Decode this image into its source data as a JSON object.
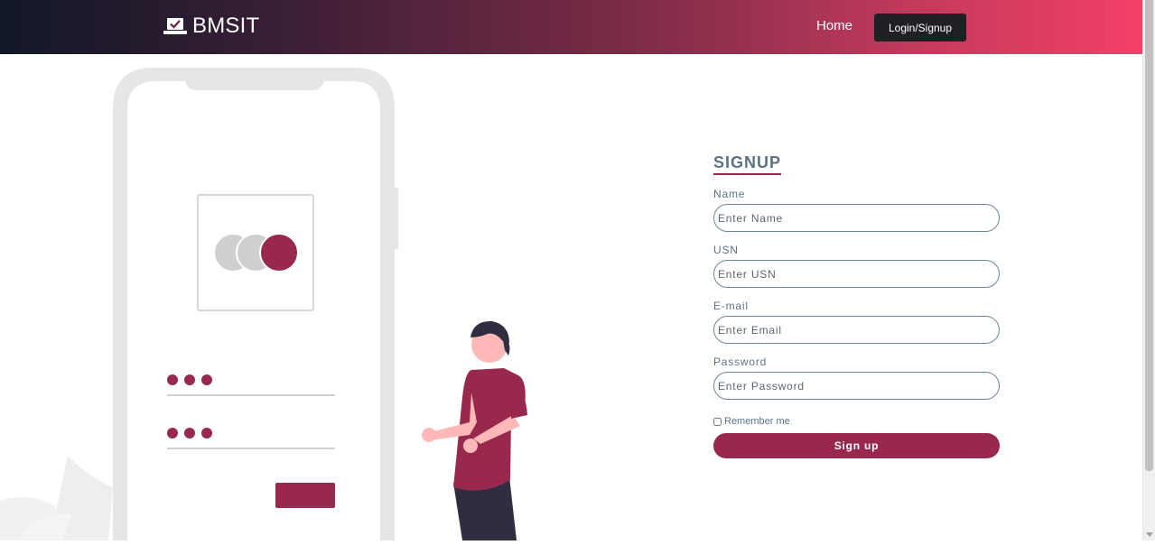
{
  "navbar": {
    "brand": "BMSIT",
    "brand_icon": "laptop-check-icon",
    "home_link": "Home",
    "login_button": "Login/Signup",
    "gradient_start": "#111827",
    "gradient_end": "#f43f67"
  },
  "form": {
    "title": "SIGNUP",
    "fields": [
      {
        "label": "Name",
        "placeholder": "Enter Name",
        "value": ""
      },
      {
        "label": "USN",
        "placeholder": "Enter USN",
        "value": ""
      },
      {
        "label": "E-mail",
        "placeholder": "Enter Email",
        "value": ""
      },
      {
        "label": "Password",
        "placeholder": "Enter Password",
        "value": ""
      }
    ],
    "remember_label": "Remember me",
    "submit_label": "Sign up",
    "accent_color": "#99294c"
  },
  "illustration": {
    "icons": [
      "phone-mockup-icon",
      "person-figure-icon",
      "leaf-decoration-icon"
    ]
  }
}
